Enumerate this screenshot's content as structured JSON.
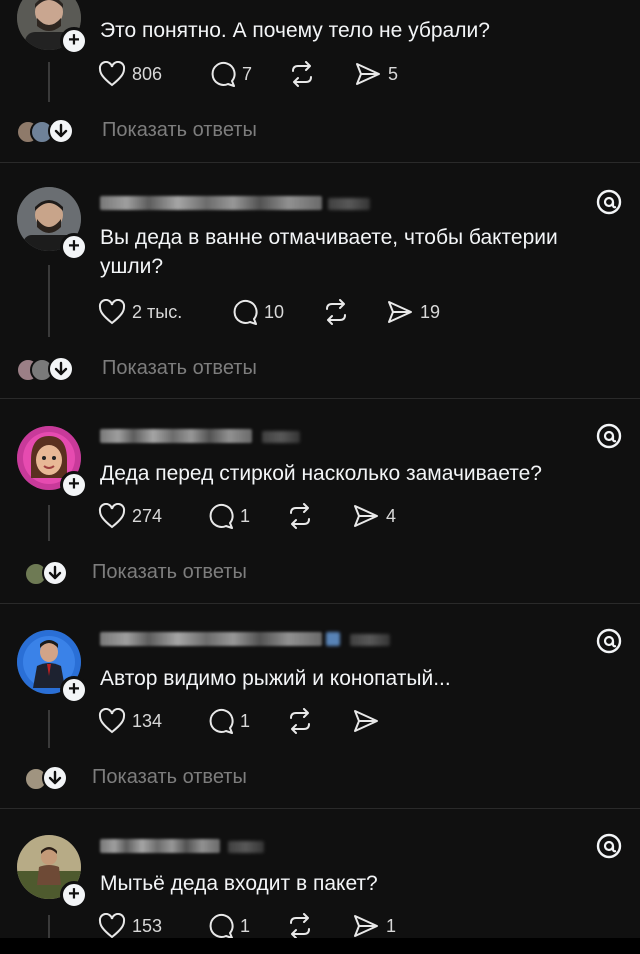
{
  "posts": [
    {
      "text": "Это понятно. А почему тело не убрали?",
      "likes": "806",
      "comments": "7",
      "shares": "5",
      "replies_label": "Показать ответы"
    },
    {
      "text": "Вы деда в ванне отмачиваете, чтобы бактерии ушли?",
      "likes": "2 тыс.",
      "comments": "10",
      "shares": "19",
      "replies_label": "Показать ответы"
    },
    {
      "text": "Деда перед стиркой насколько замачиваете?",
      "likes": "274",
      "comments": "1",
      "shares": "4",
      "replies_label": "Показать ответы"
    },
    {
      "text": "Автор видимо рыжий и конопатый...",
      "likes": "134",
      "comments": "1",
      "shares": "",
      "replies_label": "Показать ответы"
    },
    {
      "text": "Мытьё деда входит в пакет?",
      "likes": "153",
      "comments": "1",
      "shares": "1",
      "replies_label": ""
    }
  ],
  "colors": {
    "background": "#101010",
    "text": "#f3f5f7",
    "muted": "#7d7d7d",
    "divider": "#2a2a2a"
  },
  "icons": [
    "heart-icon",
    "comment-icon",
    "repost-icon",
    "send-icon",
    "threads-logo-icon",
    "plus-icon",
    "arrow-down-icon"
  ]
}
